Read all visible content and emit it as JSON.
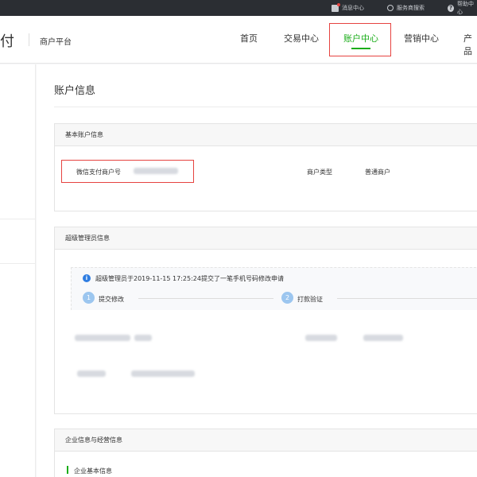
{
  "topbar": {
    "message_center": "消息中心",
    "service_search": "服务商搜索",
    "help": "帮助中心"
  },
  "header": {
    "brand": "付",
    "brand_sub": "商户平台",
    "nav": [
      "首页",
      "交易中心",
      "账户中心",
      "营销中心",
      "产品"
    ],
    "active_nav": "账户中心"
  },
  "main": {
    "page_title": "账户信息",
    "basic_panel": {
      "title": "基本账户信息",
      "merchant_id_label": "微信支付商户号",
      "merchant_type_label": "商户类型",
      "merchant_type_value": "普通商户"
    },
    "admin_panel": {
      "title": "超级管理员信息",
      "notice": "超级管理员于2019-11-15 17:25:24提交了一笔手机号码修改申请",
      "steps": [
        {
          "num": "1",
          "label": "提交修改"
        },
        {
          "num": "2",
          "label": "打款验证"
        }
      ]
    },
    "company_panel": {
      "title": "企业信息与经营信息",
      "sub_title": "企业基本信息"
    }
  },
  "colors": {
    "accent": "#1aad19",
    "highlight_box": "#e64340",
    "info": "#2f7de1",
    "step": "#9cc6ef"
  }
}
